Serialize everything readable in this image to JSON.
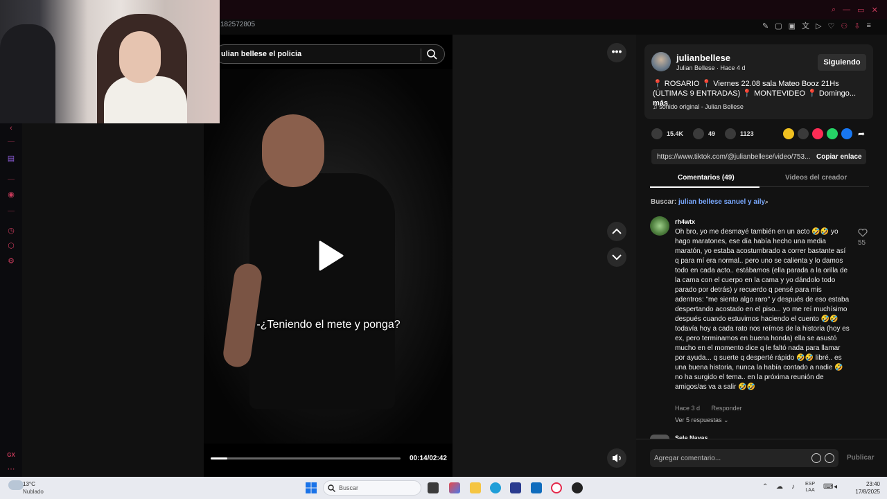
{
  "browser": {
    "url_fragment": "182572805"
  },
  "search": {
    "query": "ulian bellese el policia"
  },
  "video": {
    "subtitle": "-¿Teniendo el mete y ponga?",
    "time": "00:14/02:42",
    "progress_fraction": 0.086
  },
  "creator": {
    "name": "julianbellese",
    "display": "Julian Bellese · Hace 4 d",
    "follow_label": "Siguiendo",
    "description": "📍 ROSARIO 📍 Viernes 22.08 sala Mateo Booz 21Hs (ÚLTIMAS 9 ENTRADAS) 📍 MONTEVIDEO 📍 Domingo...",
    "more_label": "más",
    "sound": "♫  sonido original - Julian Bellese"
  },
  "stats": {
    "likes": "15.4K",
    "comments": "49",
    "saves": "1123"
  },
  "link": {
    "url": "https://www.tiktok.com/@julianbellese/video/753...",
    "copy_label": "Copiar enlace"
  },
  "tabs": {
    "comments": "Comentarios (49)",
    "creator_videos": "Videos del creador"
  },
  "comment_search": {
    "label": "Buscar: ",
    "term": "julian bellese sanuel y aily"
  },
  "comment": {
    "user": "rh4wtx",
    "text": "Oh bro, yo me desmayé también en un acto 🤣🤣 yo hago maratones, ese día había hecho una media maratón, yo estaba acostumbrado a correr bastante así q para mí era normal.. pero uno se calienta y lo damos todo en cada acto.. estábamos (ella parada a la orilla de la cama con el cuerpo en la cama y yo dándolo todo parado por detrás) y recuerdo q pensé para mis adentros: \"me siento algo raro\" y después de eso estaba despertando acostado en el piso... yo me reí muchísimo después cuando estuvimos haciendo el cuento 🤣🤣 todavía hoy a cada rato nos reímos de la historia (hoy es ex, pero terminamos en buena honda) ella se asustó mucho en el momento dice q le faltó nada para llamar por ayuda... q suerte q desperté rápido 🤣🤣 libré.. es una buena historia, nunca la había contado a nadie 🤣 no ha surgido el tema.. en la próxima reunión de amigos/as va a salir 🤣🤣",
    "time": "Hace 3 d",
    "reply_label": "Responder",
    "replies": "Ver 5 respuestas ⌄",
    "likes": "55"
  },
  "comment2": {
    "user": "Sele Navas"
  },
  "composer": {
    "placeholder": "Agregar comentario...",
    "publish_label": "Publicar"
  },
  "taskbar": {
    "temp": "13°C",
    "condition": "Nublado",
    "search": "Buscar",
    "lang_top": "ESP",
    "lang_bottom": "LAA",
    "time": "23:40",
    "date": "17/8/2025"
  },
  "sidebar": {
    "label": "GX"
  }
}
